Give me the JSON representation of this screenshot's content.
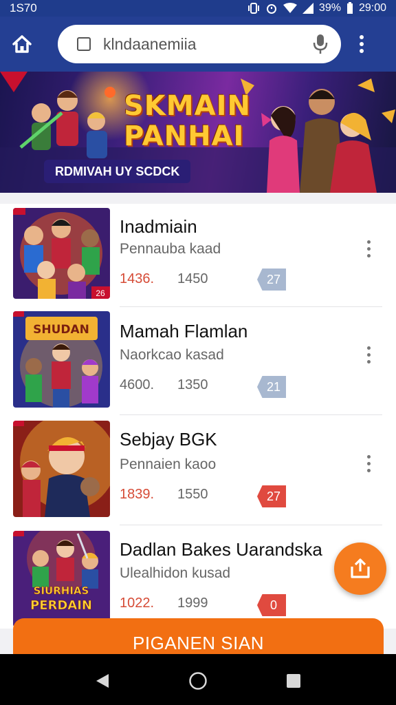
{
  "status_bar": {
    "left_text": "1S70",
    "battery": "39%",
    "time": "29:00"
  },
  "search": {
    "query": "klndaanemiia"
  },
  "banner": {
    "title_line1": "SKMAIN",
    "title_line2": "PANHAI",
    "subtitle": "RDMIVAH UY SCDCK"
  },
  "items": [
    {
      "title": "Inadmiain",
      "subtitle": "Pennauba kaad",
      "stat1": "1436.",
      "stat2": "1450",
      "badge": "27",
      "stat1_color": "#d64b36",
      "badge_style": "blue",
      "thumb_corner": "26"
    },
    {
      "title": "Mamah Flamlan",
      "subtitle": "Naorkcao kasad",
      "stat1": "4600.",
      "stat2": "1350",
      "badge": "21",
      "stat1_color": "#666666",
      "badge_style": "blue",
      "thumb_banner": "SHUDAN"
    },
    {
      "title": "Sebjay BGK",
      "subtitle": "Pennaien kaoo",
      "stat1": "1839.",
      "stat2": "1550",
      "badge": "27",
      "stat1_color": "#d64b36",
      "badge_style": "red"
    },
    {
      "title": "Dadlan Bakes Uarandska",
      "subtitle": "Ulealhidon kusad",
      "stat1": "1022.",
      "stat2": "1999",
      "badge": "0",
      "stat1_color": "#d64b36",
      "badge_style": "red",
      "thumb_banner_line1": "SIURHIAS",
      "thumb_banner_line2": "PERDAIN"
    }
  ],
  "cta": {
    "label": "PIGANEN SIAN"
  },
  "icons": {
    "home": "home-icon",
    "mic": "mic-icon",
    "more": "more-vert-icon",
    "share": "share-icon",
    "back": "back-icon",
    "home_nav": "home-circle-icon",
    "recents": "recents-icon"
  },
  "colors": {
    "app_bar": "#243f93",
    "accent": "#f26f12",
    "fab": "#f57c1f",
    "badge_red": "#e04a3f",
    "badge_blue": "#a8b8d0"
  }
}
